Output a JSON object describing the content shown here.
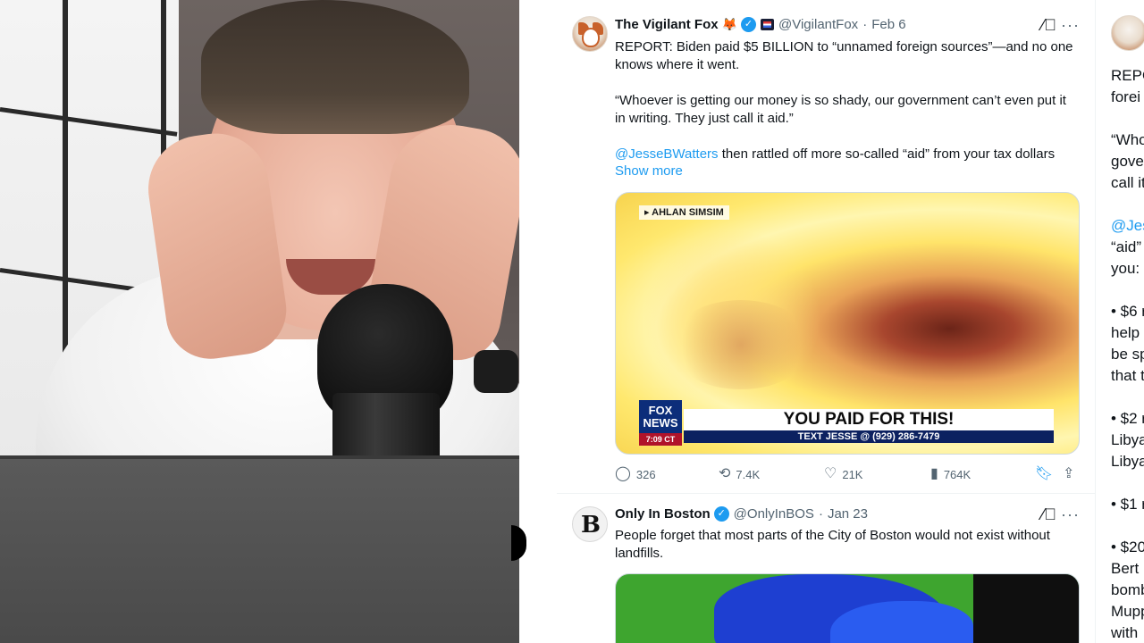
{
  "tweet1": {
    "display_name": "The Vigilant Fox",
    "emoji": "🦊",
    "handle": "@VigilantFox",
    "separator": "·",
    "date": "Feb 6",
    "paragraph1": "REPORT: Biden paid $5 BILLION to “unnamed foreign sources”—and no one knows where it went.",
    "paragraph2": "“Whoever is getting our money is so shady, our government can’t even put it in writing. They just call it aid.”",
    "mention": "@JesseBWatters",
    "paragraph3_rest": " then rattled off more so-called “aid” from your tax dollars",
    "show_more": "Show more",
    "media": {
      "tag": "▸ AHLAN SIMSIM",
      "logo_line1": "FOX",
      "logo_line2": "NEWS",
      "logo_time": "7:09 CT",
      "headline": "YOU PAID FOR THIS!",
      "subline": "TEXT JESSE @ (929) 286-7479"
    },
    "stats": {
      "replies": "326",
      "retweets": "7.4K",
      "likes": "21K",
      "views": "764K"
    }
  },
  "tweet2": {
    "avatar_letter": "B",
    "display_name": "Only In Boston",
    "handle": "@OnlyInBOS",
    "separator": "·",
    "date": "Jan 23",
    "text": "People forget that most parts of the City of Boston would not exist without landfills."
  },
  "right_column": {
    "lines": [
      "REPO",
      "forei",
      "",
      "“Who",
      "gove",
      "call it",
      "",
      "@Jes",
      "“aid”",
      "you:",
      "",
      "• $6 r",
      "help",
      "be sp",
      "that t",
      "",
      "• $2 r",
      "Libya",
      "Libya",
      "",
      "• $1 r",
      "",
      "• $20",
      "Bert",
      "bomb",
      "Mupp",
      "with"
    ]
  },
  "colors": {
    "accent": "#1d9bf0",
    "text_primary": "#0f1419",
    "text_secondary": "#536471"
  },
  "icons": {
    "reply": "reply-icon",
    "retweet": "retweet-icon",
    "like": "heart-icon",
    "views": "views-icon",
    "bookmark": "bookmark-icon",
    "share": "share-icon",
    "grok": "grok-icon",
    "more": "more-icon"
  }
}
